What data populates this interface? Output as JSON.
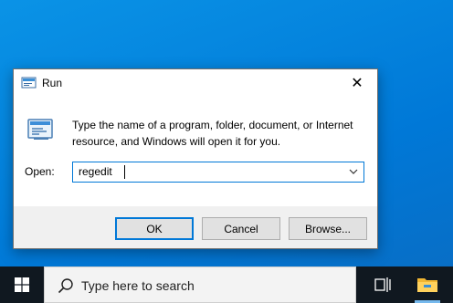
{
  "colors": {
    "desktop": "#0078d7",
    "taskbar": "#101820",
    "accent": "#0078d7"
  },
  "dialog": {
    "title": "Run",
    "title_icon": "run-icon",
    "close_glyph": "✕",
    "description": "Type the name of a program, folder, document, or Internet resource, and Windows will open it for you.",
    "open_label": "Open:",
    "open_value": "regedit",
    "buttons": {
      "ok": "OK",
      "cancel": "Cancel",
      "browse": "Browse..."
    }
  },
  "taskbar": {
    "start_icon": "windows-logo-icon",
    "search_placeholder": "Type here to search",
    "task_view_icon": "task-view-icon",
    "pinned_app_icon": "file-explorer-icon"
  }
}
